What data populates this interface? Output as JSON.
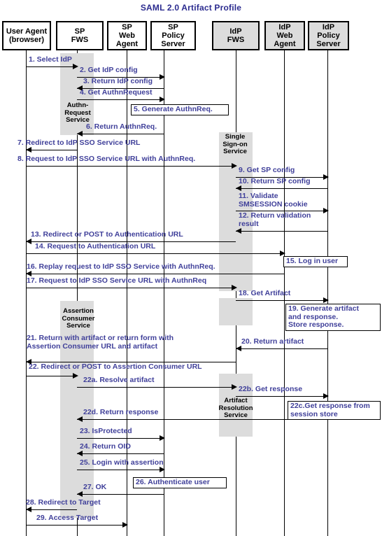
{
  "diagram": {
    "title": "SAML 2.0 Artifact Profile",
    "accent_color": "#40409a",
    "title_color": "#2b2b8f",
    "activation_color": "#dcdcdc"
  },
  "participants": [
    {
      "id": "ua",
      "label": "User Agent\n(browser)",
      "shaded": false
    },
    {
      "id": "spf",
      "label": "SP\nFWS",
      "shaded": false
    },
    {
      "id": "spw",
      "label": "SP\nWeb\nAgent",
      "shaded": false
    },
    {
      "id": "spp",
      "label": "SP\nPolicy\nServer",
      "shaded": false
    },
    {
      "id": "idf",
      "label": "IdP\nFWS",
      "shaded": true
    },
    {
      "id": "idw",
      "label": "IdP\nWeb\nAgent",
      "shaded": true
    },
    {
      "id": "idp",
      "label": "IdP\nPolicy\nServer",
      "shaded": true
    }
  ],
  "activation_labels": [
    {
      "text": "Authn-\nRequest\nService"
    },
    {
      "text": "Single\nSign-on\nService"
    },
    {
      "text": "Assertion\nConsumer\nService"
    },
    {
      "text": "Artifact\nResolution\nService"
    }
  ],
  "messages": [
    {
      "n": "1",
      "text": "1. Select IdP",
      "from": "ua",
      "to": "spf"
    },
    {
      "n": "2",
      "text": "2. Get IdP config",
      "from": "spf",
      "to": "spp"
    },
    {
      "n": "3",
      "text": "3. Return IdP config",
      "from": "spp",
      "to": "spf"
    },
    {
      "n": "4",
      "text": "4. Get AuthnRequest",
      "from": "spf",
      "to": "spp"
    },
    {
      "n": "6",
      "text": "6. Return AuthnReq.",
      "from": "spp",
      "to": "spf"
    },
    {
      "n": "7",
      "text": "7. Redirect to IdP SSO Service URL",
      "from": "spf",
      "to": "ua"
    },
    {
      "n": "8",
      "text": "8. Request to IdP SSO Service URL with AuthnReq.",
      "from": "ua",
      "to": "idf"
    },
    {
      "n": "9",
      "text": "9. Get SP config",
      "from": "idf",
      "to": "idp"
    },
    {
      "n": "10",
      "text": "10. Return SP config",
      "from": "idp",
      "to": "idf"
    },
    {
      "n": "11",
      "text": "11. Validate\n     SMSESSION cookie",
      "from": "idf",
      "to": "idp"
    },
    {
      "n": "12",
      "text": "12. Return validation\n      result",
      "from": "idp",
      "to": "idf"
    },
    {
      "n": "13",
      "text": "13. Redirect or POST to Authentication URL",
      "from": "idf",
      "to": "ua"
    },
    {
      "n": "14",
      "text": "14. Request to Authentication URL",
      "from": "ua",
      "to": "idw"
    },
    {
      "n": "16",
      "text": "16. Replay request to IdP SSO Service with AuthnReq.",
      "from": "idw",
      "to": "ua"
    },
    {
      "n": "17",
      "text": "17. Request to IdP SSO Service URL with AuthnReq",
      "from": "ua",
      "to": "idf"
    },
    {
      "n": "18",
      "text": "18. Get Artifact",
      "from": "idf",
      "to": "idp"
    },
    {
      "n": "20",
      "text": "20. Return artifact",
      "from": "idp",
      "to": "idf"
    },
    {
      "n": "21",
      "text": "21. Return with artifact or return form with\n      Assertion Consumer URL and artifact",
      "from": "idf",
      "to": "ua"
    },
    {
      "n": "22",
      "text": "22. Redirect or POST to Assertion Consumer URL",
      "from": "ua",
      "to": "spf"
    },
    {
      "n": "22a",
      "text": "22a. Resolve artifact",
      "from": "spf",
      "to": "idf"
    },
    {
      "n": "22b",
      "text": "22b. Get response",
      "from": "idf",
      "to": "idp"
    },
    {
      "n": "22d",
      "text": "22d. Return response",
      "from": "idp",
      "to": "spf"
    },
    {
      "n": "23",
      "text": "23. IsProtected",
      "from": "spf",
      "to": "spp"
    },
    {
      "n": "24",
      "text": "24. Return OID",
      "from": "spp",
      "to": "spf"
    },
    {
      "n": "25",
      "text": "25. Login with assertion",
      "from": "spf",
      "to": "spp"
    },
    {
      "n": "27",
      "text": "27. OK",
      "from": "spp",
      "to": "spf"
    },
    {
      "n": "28",
      "text": "28. Redirect to Target",
      "from": "spf",
      "to": "ua"
    },
    {
      "n": "29",
      "text": "29. Access Target",
      "from": "ua",
      "to": "spw"
    }
  ],
  "notes": [
    {
      "n": "5",
      "text": "5. Generate AuthnReq."
    },
    {
      "n": "15",
      "text": "15. Log in user"
    },
    {
      "n": "19",
      "text": "19. Generate artifact\n      and response.\n      Store response."
    },
    {
      "n": "22c",
      "text": "22c.Get response from\n       session store"
    },
    {
      "n": "26",
      "text": "26. Authenticate user"
    }
  ]
}
